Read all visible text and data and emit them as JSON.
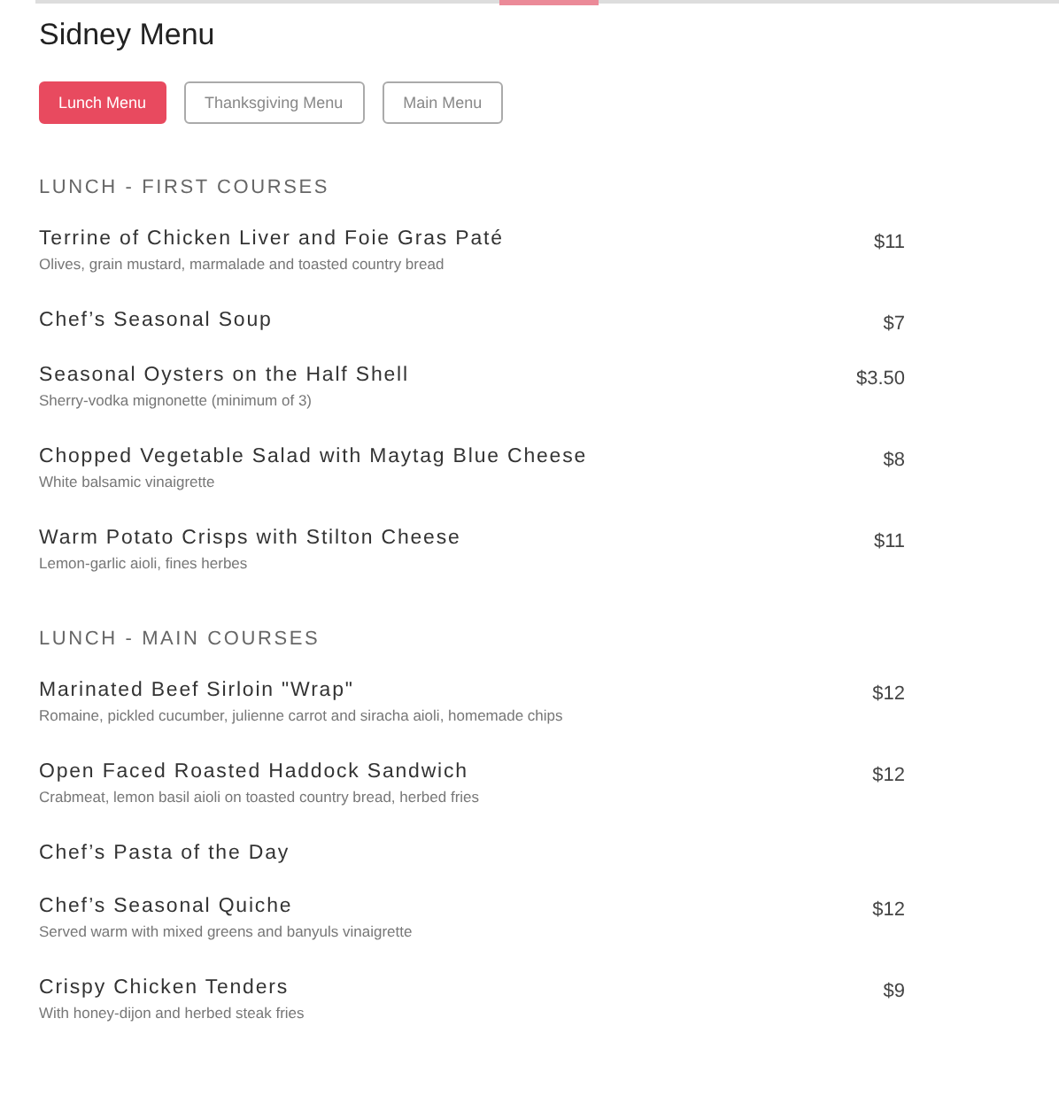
{
  "title": "Sidney Menu",
  "menu_tabs": [
    {
      "label": "Lunch Menu",
      "selected": true
    },
    {
      "label": "Thanksgiving Menu",
      "selected": false
    },
    {
      "label": "Main Menu",
      "selected": false
    }
  ],
  "sections": [
    {
      "heading": "LUNCH - FIRST COURSES",
      "items": [
        {
          "name": "Terrine of Chicken Liver and Foie Gras Paté",
          "description": "Olives, grain mustard, marmalade and toasted country bread",
          "price": "$11"
        },
        {
          "name": "Chef’s Seasonal Soup",
          "price": "$7"
        },
        {
          "name": "Seasonal Oysters on the Half Shell",
          "description": "Sherry-vodka mignonette (minimum of 3)",
          "price": "$3.50"
        },
        {
          "name": "Chopped Vegetable Salad with Maytag Blue Cheese",
          "description": "White balsamic vinaigrette",
          "price": "$8"
        },
        {
          "name": "Warm Potato Crisps with Stilton Cheese",
          "description": "Lemon-garlic aioli, fines herbes",
          "price": "$11"
        }
      ]
    },
    {
      "heading": "LUNCH - MAIN COURSES",
      "items": [
        {
          "name": "Marinated Beef Sirloin \"Wrap\"",
          "description": "Romaine, pickled cucumber, julienne carrot and siracha aioli, homemade chips",
          "price": "$12"
        },
        {
          "name": "Open Faced Roasted Haddock Sandwich",
          "description": "Crabmeat, lemon basil aioli on toasted country bread, herbed fries",
          "price": "$12"
        },
        {
          "name": "Chef’s Pasta of the Day"
        },
        {
          "name": "Chef’s Seasonal Quiche",
          "description": "Served warm with mixed greens and banyuls vinaigrette",
          "price": "$12"
        },
        {
          "name": "Crispy Chicken Tenders",
          "description": "With honey-dijon and herbed steak fries",
          "price": "$9"
        }
      ]
    }
  ]
}
